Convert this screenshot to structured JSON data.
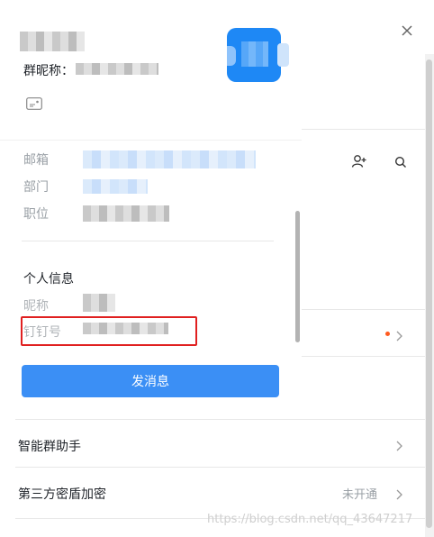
{
  "window": {
    "close_icon": "close-icon"
  },
  "card": {
    "group_nickname_label": "群昵称：",
    "card_icon": "id-card-icon"
  },
  "right_panel": {
    "add_member_icon": "add-person-icon",
    "search_icon": "search-icon"
  },
  "profile": {
    "fields": [
      {
        "label": "邮箱"
      },
      {
        "label": "部门"
      },
      {
        "label": "职位"
      }
    ],
    "personal_info_title": "个人信息",
    "nickname_label": "昵称",
    "dingtalk_id_label": "钉钉号",
    "send_message_label": "发消息"
  },
  "settings": {
    "smart_assistant_label": "智能群助手",
    "third_party_encryption_label": "第三方密盾加密",
    "third_party_encryption_status": "未开通"
  },
  "watermark": "https://blog.csdn.net/qq_43647217",
  "colors": {
    "accent": "#3b8ff5",
    "highlight_box": "#e02020",
    "badge_dot": "#ff5a1f"
  }
}
